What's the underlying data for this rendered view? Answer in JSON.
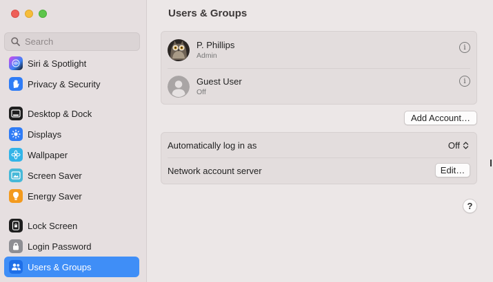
{
  "window": {
    "controls": [
      "close",
      "minimize",
      "zoom"
    ]
  },
  "search": {
    "placeholder": "Search",
    "value": "",
    "icon": "search-icon"
  },
  "sidebar": {
    "items": [
      {
        "label": "Siri & Spotlight",
        "icon": "siri-icon",
        "active": false
      },
      {
        "label": "Privacy & Security",
        "icon": "hand-icon",
        "active": false
      },
      {
        "label": "Desktop & Dock",
        "icon": "dock-icon",
        "active": false
      },
      {
        "label": "Displays",
        "icon": "sun-icon",
        "active": false
      },
      {
        "label": "Wallpaper",
        "icon": "flower-icon",
        "active": false
      },
      {
        "label": "Screen Saver",
        "icon": "screen-saver-icon",
        "active": false
      },
      {
        "label": "Energy Saver",
        "icon": "lightbulb-icon",
        "active": false
      },
      {
        "label": "Lock Screen",
        "icon": "lock-screen-icon",
        "active": false
      },
      {
        "label": "Login Password",
        "icon": "padlock-icon",
        "active": false
      },
      {
        "label": "Users & Groups",
        "icon": "users-icon",
        "active": true
      }
    ]
  },
  "main": {
    "title": "Users & Groups",
    "users": [
      {
        "name": "P. Phillips",
        "role": "Admin",
        "avatar": "owl-avatar"
      },
      {
        "name": "Guest User",
        "role": "Off",
        "avatar": "guest-avatar"
      }
    ],
    "info_glyph": "i",
    "add_account_label": "Add Account…",
    "settings": {
      "auto_login": {
        "label": "Automatically log in as",
        "value": "Off"
      },
      "network_server": {
        "label": "Network account server",
        "button": "Edit…"
      }
    },
    "help_glyph": "?"
  },
  "colors": {
    "accent": "#3f8ef7",
    "sidebar_bg": "#e6dfe0",
    "content_bg": "#ece7e7"
  }
}
